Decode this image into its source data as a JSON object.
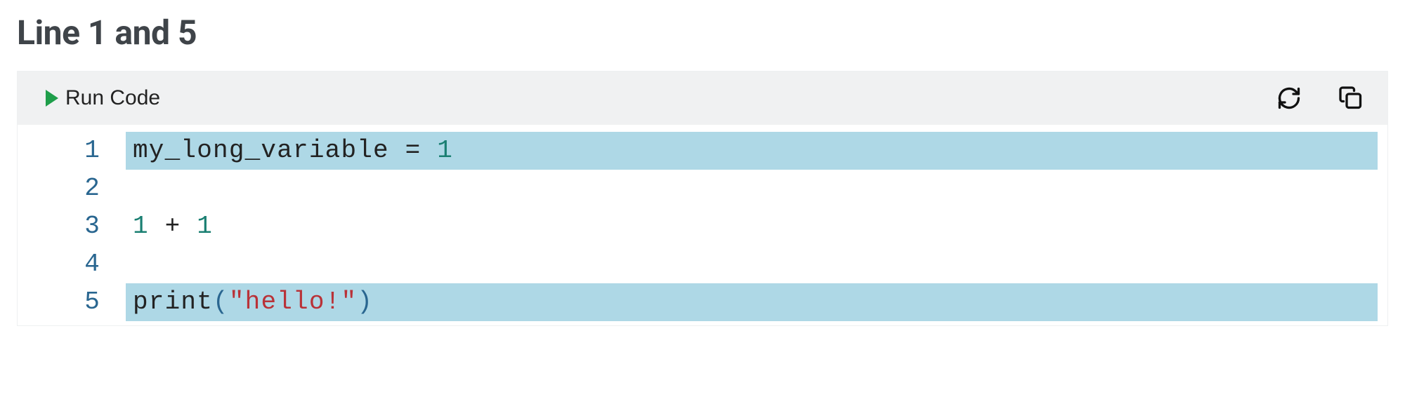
{
  "heading": "Line 1 and 5",
  "toolbar": {
    "run_label": "Run Code",
    "refresh_label": "Refresh",
    "copy_label": "Copy"
  },
  "code": {
    "lines": [
      {
        "number": "1",
        "highlighted": true,
        "tokens": {
          "var": "my_long_variable",
          "eq": " = ",
          "val": "1"
        }
      },
      {
        "number": "2",
        "highlighted": false,
        "tokens": {
          "text": ""
        }
      },
      {
        "number": "3",
        "highlighted": false,
        "tokens": {
          "lhs": "1",
          "op": " + ",
          "rhs": "1"
        }
      },
      {
        "number": "4",
        "highlighted": false,
        "tokens": {
          "text": ""
        }
      },
      {
        "number": "5",
        "highlighted": true,
        "tokens": {
          "fn": "print",
          "lparen": "(",
          "str": "\"hello!\"",
          "rparen": ")"
        }
      }
    ]
  }
}
